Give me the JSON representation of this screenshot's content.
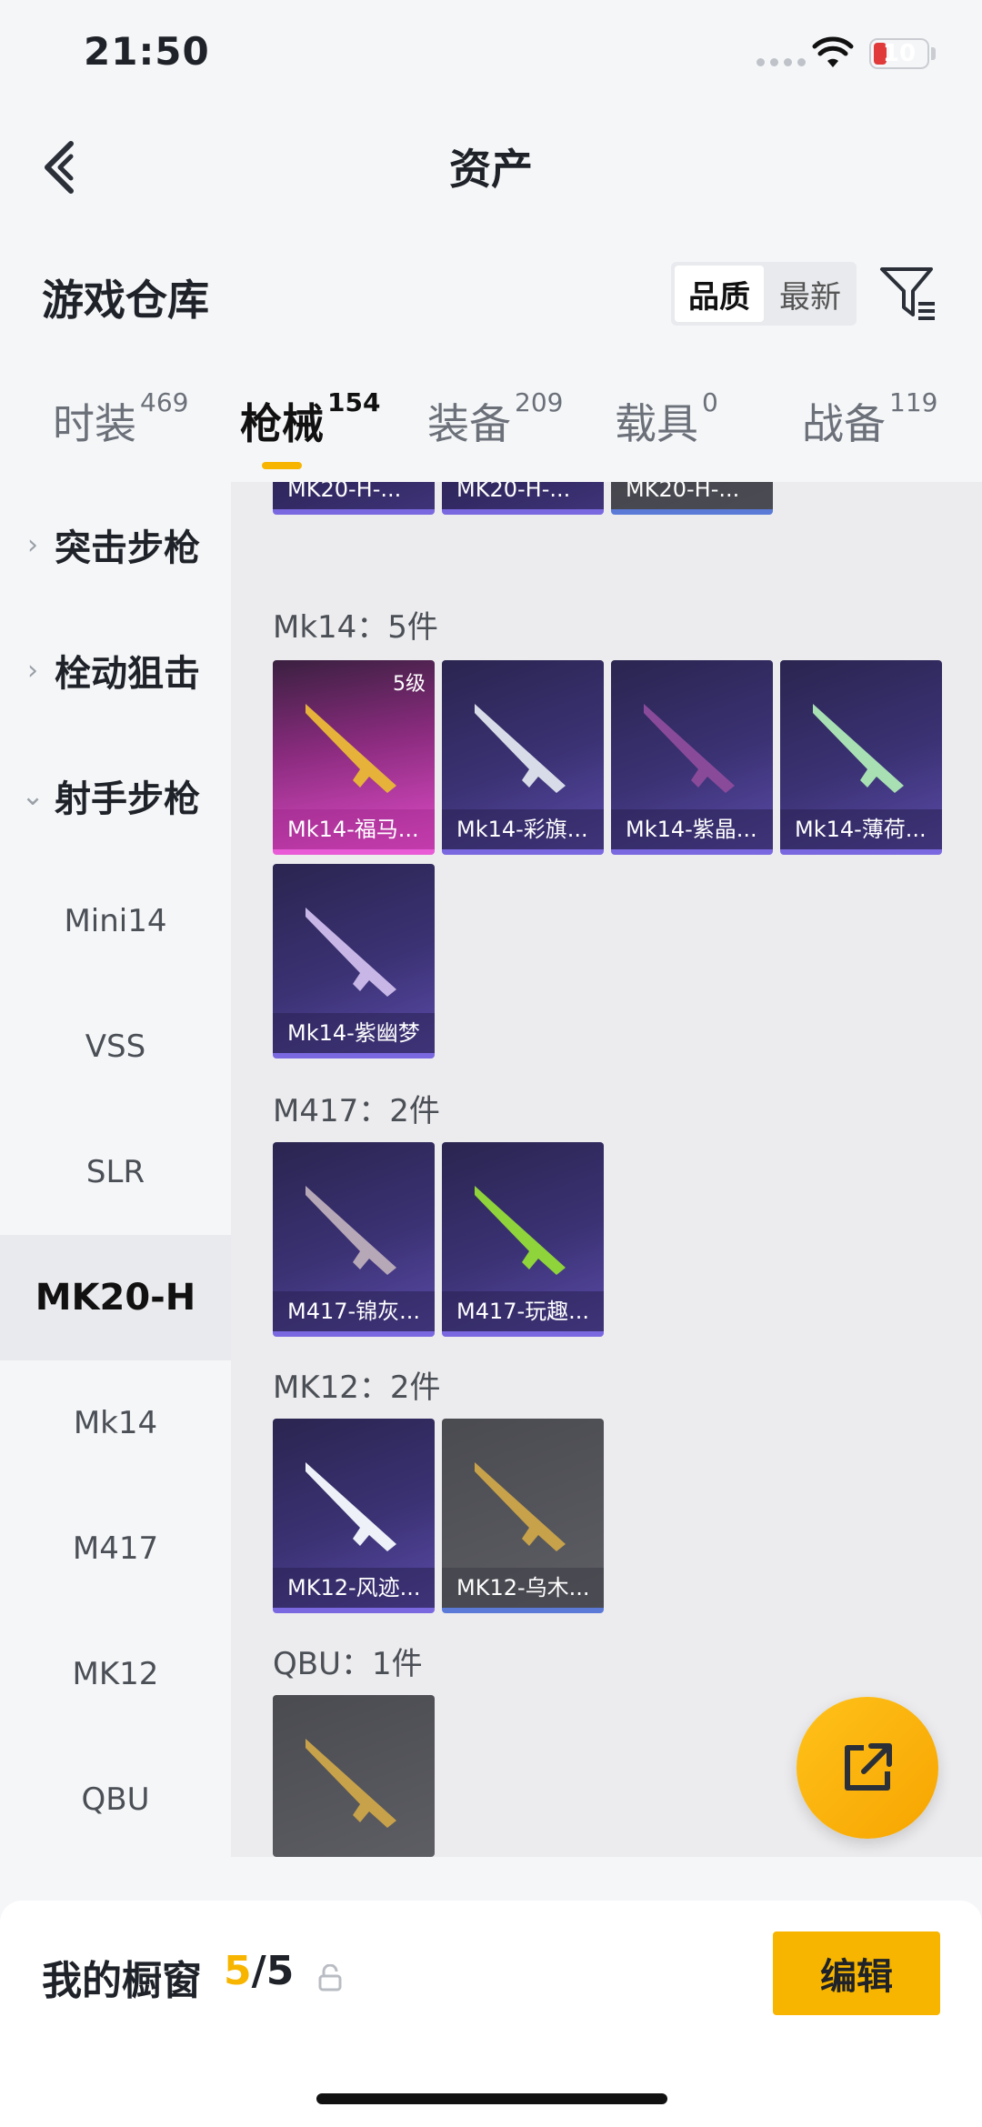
{
  "status": {
    "time": "21:50",
    "battery": "10"
  },
  "nav": {
    "title": "资产"
  },
  "header": {
    "title": "游戏仓库",
    "sort_options": [
      "品质",
      "最新"
    ]
  },
  "tabs": [
    {
      "label": "时装",
      "count": "469"
    },
    {
      "label": "枪械",
      "count": "154"
    },
    {
      "label": "装备",
      "count": "209"
    },
    {
      "label": "载具",
      "count": "0"
    },
    {
      "label": "战备",
      "count": "119"
    }
  ],
  "sidebar": {
    "groups": [
      "突击步枪",
      "栓动狙击",
      "射手步枪"
    ],
    "items": [
      "Mini14",
      "VSS",
      "SLR",
      "MK20-H",
      "Mk14",
      "M417",
      "MK12",
      "QBU"
    ]
  },
  "sections": {
    "mk20h": {
      "cards": [
        "MK20-H-...",
        "MK20-H-...",
        "MK20-H-..."
      ]
    },
    "mk14": {
      "label": "Mk14：5件",
      "cards": [
        "Mk14-福马...",
        "Mk14-彩旗...",
        "Mk14-紫晶...",
        "Mk14-薄荷...",
        "Mk14-紫幽梦"
      ],
      "level": "5级"
    },
    "m417": {
      "label": "M417：2件",
      "cards": [
        "M417-锦灰...",
        "M417-玩趣..."
      ]
    },
    "mk12": {
      "label": "MK12：2件",
      "cards": [
        "MK12-风迹...",
        "MK12-乌木..."
      ]
    },
    "qbu": {
      "label": "QBU：1件"
    }
  },
  "showcase": {
    "label": "我的橱窗",
    "current": "5",
    "total": "/5",
    "edit": "编辑"
  }
}
